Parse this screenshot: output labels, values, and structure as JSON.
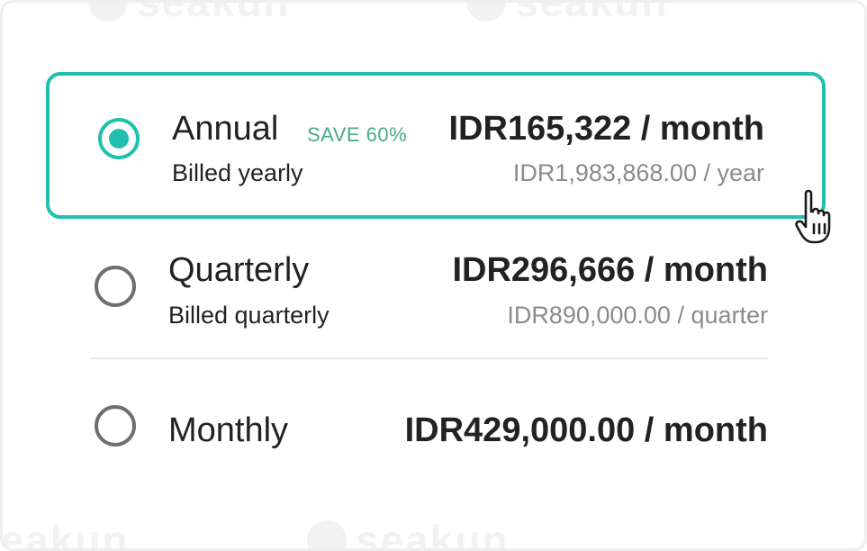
{
  "plans": [
    {
      "name": "Annual",
      "badge": "SAVE 60%",
      "billing": "Billed yearly",
      "price": "IDR165,322 / month",
      "total": "IDR1,983,868.00 / year",
      "selected": true
    },
    {
      "name": "Quarterly",
      "billing": "Billed quarterly",
      "price": "IDR296,666 / month",
      "total": "IDR890,000.00 / quarter",
      "selected": false
    },
    {
      "name": "Monthly",
      "price": "IDR429,000.00 / month",
      "selected": false
    }
  ],
  "watermark": "seakun",
  "colors": {
    "accent": "#20bfae",
    "badge": "#4aa98c",
    "text": "#222222",
    "muted": "#8b8b8b"
  },
  "icons": {
    "cursor": "hand-pointer-icon"
  }
}
